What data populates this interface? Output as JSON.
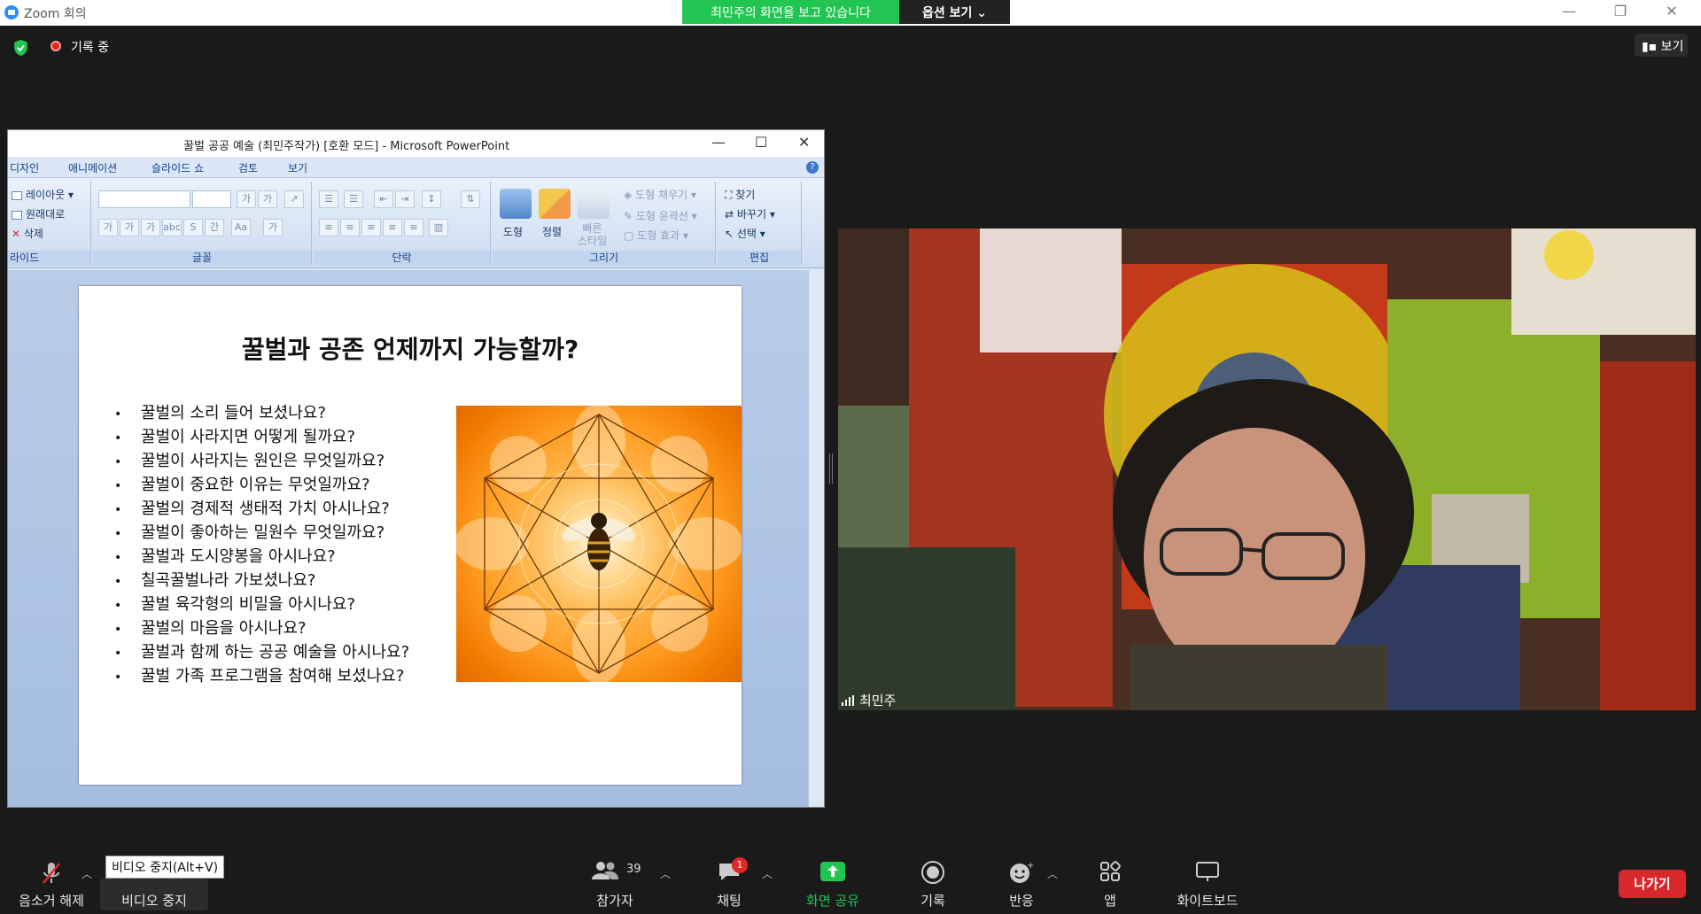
{
  "window": {
    "title": "Zoom 회의"
  },
  "share_banner": {
    "status": "최민주의 화면을 보고 있습니다",
    "options": "옵션 보기 ⌄"
  },
  "overlay": {
    "recording": "기록 중",
    "view": "보기"
  },
  "ppt": {
    "title": "꿀벌 공공 예술 (최민주작가) [호환 모드] - Microsoft PowerPoint",
    "tabs": [
      "디자인",
      "애니메이션",
      "슬라이드 쇼",
      "검토",
      "보기"
    ],
    "ribbon": {
      "slides": {
        "layout": "레이아웃",
        "reset": "원래대로",
        "delete": "삭제",
        "group": "라이드"
      },
      "font_group": "글꼴",
      "paragraph_group": "단락",
      "drawing": {
        "shape": "도형",
        "arrange": "정렬",
        "quick_styles": "빠른\n스타일",
        "fill": "도형 채우기",
        "outline": "도형 윤곽선",
        "effects": "도형 효과",
        "group": "그리기"
      },
      "editing": {
        "find": "찾기",
        "replace": "바꾸기",
        "select": "선택",
        "group": "편집"
      }
    },
    "slide": {
      "title": "꿀벌과 공존 언제까지 가능할까?",
      "bullets": [
        "꿀벌의 소리 들어 보셨나요?",
        "꿀벌이 사라지면 어떻게 될까요?",
        "꿀벌이 사라지는 원인은 무엇일까요?",
        "꿀벌이 중요한 이유는 무엇일까요?",
        "꿀벌의 경제적 생태적 가치 아시나요?",
        "꿀벌이 좋아하는 밀원수 무엇일까요?",
        "꿀벌과 도시양봉을 아시나요?",
        "칠곡꿀벌나라 가보셨나요?",
        "꿀벌 육각형의 비밀을 아시나요?",
        "꿀벌의 마음을 아시나요?",
        "꿀벌과 함께 하는 공공 예술을 아시나요?",
        "꿀벌 가족 프로그램을 참여해 보셨나요?"
      ]
    }
  },
  "participant": {
    "name": "최민주"
  },
  "toolbar": {
    "unmute": "음소거 해제",
    "tooltip": "비디오 중지(Alt+V)",
    "stop_video": "비디오 중지",
    "participants": "참가자",
    "participant_count": "39",
    "chat": "채팅",
    "chat_badge": "1",
    "share": "화면 공유",
    "record": "기록",
    "reactions": "반응",
    "apps": "앱",
    "whiteboard": "화이트보드",
    "leave": "나가기"
  }
}
